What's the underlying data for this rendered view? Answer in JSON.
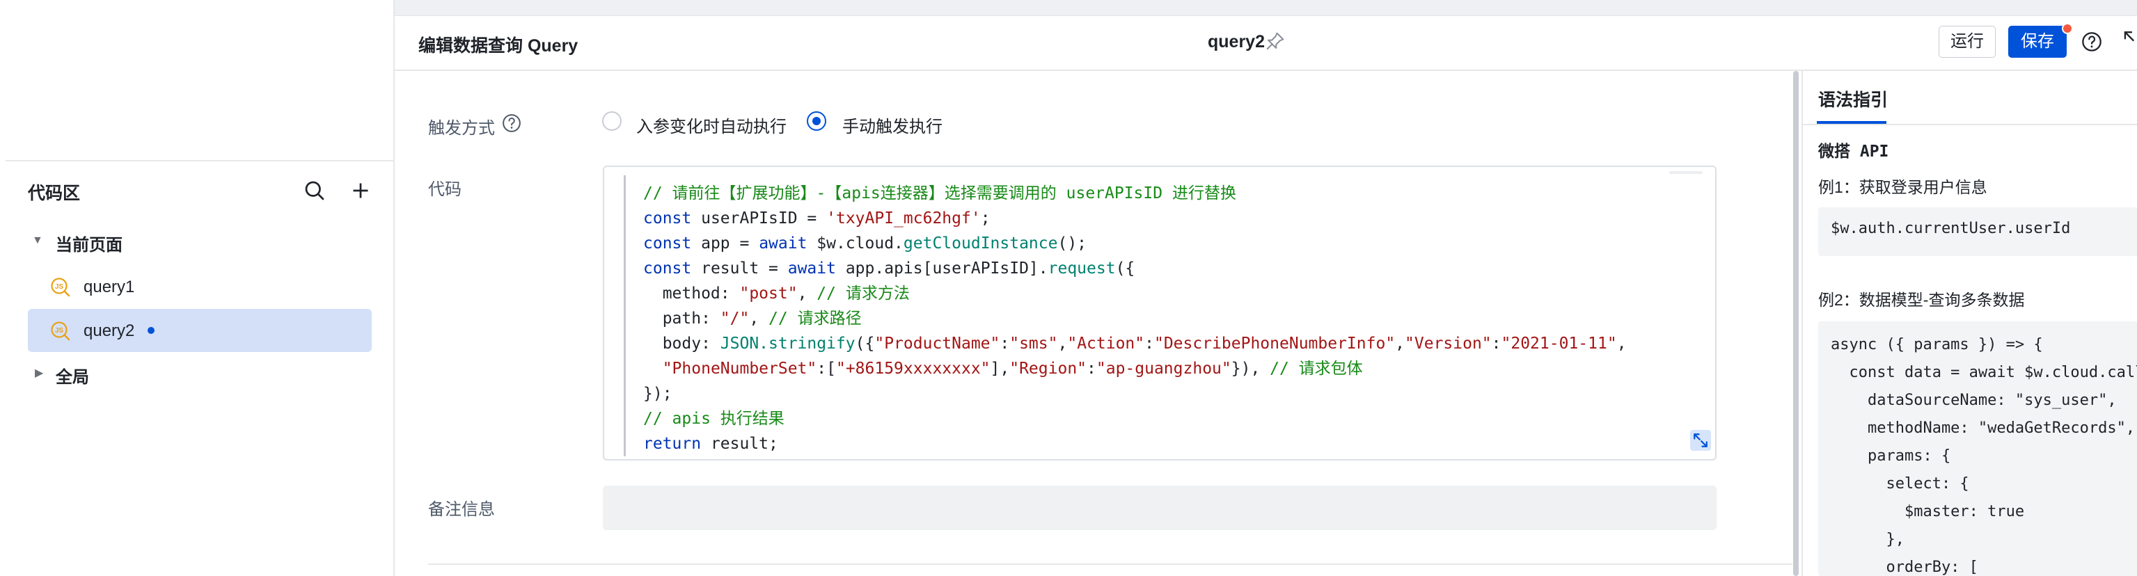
{
  "left_panel": {
    "title": "代码区",
    "tree": {
      "current_page": {
        "label": "当前页面",
        "items": [
          {
            "label": "query1",
            "icon": "js-icon"
          },
          {
            "label": "query2",
            "icon": "js-icon",
            "selected": true,
            "modified": true
          }
        ]
      },
      "global": {
        "label": "全局"
      }
    }
  },
  "header": {
    "title": "编辑数据查询 Query",
    "query_name": "query2",
    "run_label": "运行",
    "save_label": "保存"
  },
  "form": {
    "trigger_label": "触发方式",
    "trigger_options": [
      {
        "label": "入参变化时自动执行",
        "selected": false
      },
      {
        "label": "手动触发执行",
        "selected": true
      }
    ],
    "code_label": "代码",
    "remark_label": "备注信息",
    "remark_value": ""
  },
  "code_lines": [
    "// 请前往【扩展功能】-【apis连接器】选择需要调用的 userAPIsID 进行替换",
    "const userAPIsID = 'txyAPI_mc62hgf';",
    "const app = await $w.cloud.getCloudInstance();",
    "const result = await app.apis[userAPIsID].request({",
    "  method: \"post\", // 请求方法",
    "  path: \"/\", // 请求路径",
    "  body: JSON.stringify({\"ProductName\":\"sms\",\"Action\":\"DescribePhoneNumberInfo\",\"Version\":\"2021-01-11\",",
    "  \"PhoneNumberSet\":[\"+86159xxxxxxxx\"],\"Region\":\"ap-guangzhou\"}), // 请求包体",
    "});",
    "// apis 执行结果",
    "return result;"
  ],
  "guide": {
    "tab_label": "语法指引",
    "section_title": "微搭 API",
    "example1_title": "例1：获取登录用户信息",
    "example1_code": "$w.auth.currentUser.userId",
    "example2_title": "例2：数据模型-查询多条数据",
    "example2_code": "async ({ params }) => {\n  const data = await $w.cloud.callDataSource({\n    dataSourceName: \"sys_user\",\n    methodName: \"wedaGetRecords\",\n    params: {\n      select: {\n        $master: true\n      },\n      orderBy: ["
  },
  "colors": {
    "accent": "#0052d9",
    "selected_row": "#d4e0f8",
    "badge": "#f4593f"
  }
}
